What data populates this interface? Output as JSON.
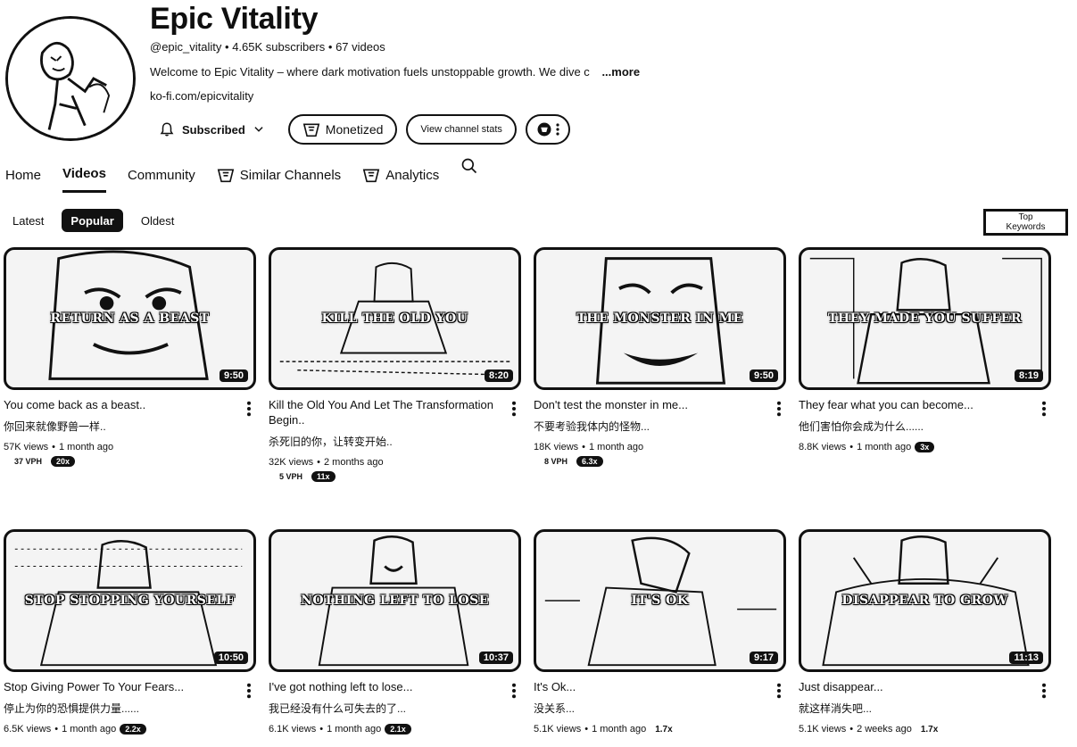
{
  "channel": {
    "title": "Epic Vitality",
    "handle": "@epic_vitality",
    "subscribers": "4.65K subscribers",
    "videos_count": "67 videos",
    "description": "Welcome to Epic Vitality – where dark motivation fuels unstoppable growth. We dive c",
    "more_label": "...more",
    "link": "ko-fi.com/epicvitality"
  },
  "actions": {
    "subscribed_label": "Subscribed",
    "monetized_label": "Monetized",
    "stats_label": "View channel stats"
  },
  "tabs": {
    "home": "Home",
    "videos": "Videos",
    "community": "Community",
    "similar": "Similar Channels",
    "analytics": "Analytics"
  },
  "filters": {
    "latest": "Latest",
    "popular": "Popular",
    "oldest": "Oldest",
    "keywords_line1": "Top",
    "keywords_line2": "Keywords"
  },
  "videos": [
    {
      "overlay": "RETURN AS A BEAST",
      "duration": "9:50",
      "title": "You come back as a beast..",
      "subtitle": "你回来就像野兽一样..",
      "views": "57K views",
      "age": "1 month ago",
      "vph": "37 VPH",
      "badge": "20x"
    },
    {
      "overlay": "KILL THE OLD YOU",
      "duration": "8:20",
      "title": "Kill the Old You And Let The Transformation Begin..",
      "subtitle": "杀死旧的你，让转变开始..",
      "views": "32K views",
      "age": "2 months ago",
      "vph": "5 VPH",
      "badge": "11x"
    },
    {
      "overlay": "THE MONSTER IN ME",
      "duration": "9:50",
      "title": "Don't test the monster in me...",
      "subtitle": "不要考验我体内的怪物...",
      "views": "18K views",
      "age": "1 month ago",
      "vph": "8 VPH",
      "badge": "6.3x"
    },
    {
      "overlay": "THEY MADE YOU SUFFER",
      "duration": "8:19",
      "title": "They fear what you can become...",
      "subtitle": "他们害怕你会成为什么......",
      "views": "8.8K views",
      "age": "1 month ago",
      "vph": "",
      "badge": "3x"
    },
    {
      "overlay": "STOP STOPPING YOURSELF",
      "duration": "10:50",
      "title": "Stop Giving Power To Your Fears...",
      "subtitle": "停止为你的恐惧提供力量......",
      "views": "6.5K views",
      "age": "1 month ago",
      "vph": "",
      "badge": "2.2x"
    },
    {
      "overlay": "NOTHING LEFT TO LOSE",
      "duration": "10:37",
      "title": "I've got nothing left to lose...",
      "subtitle": "我已经没有什么可失去的了...",
      "views": "6.1K views",
      "age": "1 month ago",
      "vph": "",
      "badge": "2.1x"
    },
    {
      "overlay": "IT'S OK",
      "duration": "9:17",
      "title": "It's Ok...",
      "subtitle": "没关系...",
      "views": "5.1K views",
      "age": "1 month ago",
      "vph": "",
      "badge": "1.7x"
    },
    {
      "overlay": "DISAPPEAR TO GROW",
      "duration": "11:13",
      "title": "Just disappear...",
      "subtitle": "就这样消失吧...",
      "views": "5.1K views",
      "age": "2 weeks ago",
      "vph": "",
      "badge": "1.7x"
    }
  ],
  "icons": {
    "bell": "bell-icon",
    "chevron": "chevron-down-icon",
    "monetized": "monetized-icon",
    "more": "more-vert-icon",
    "search": "search-icon"
  }
}
